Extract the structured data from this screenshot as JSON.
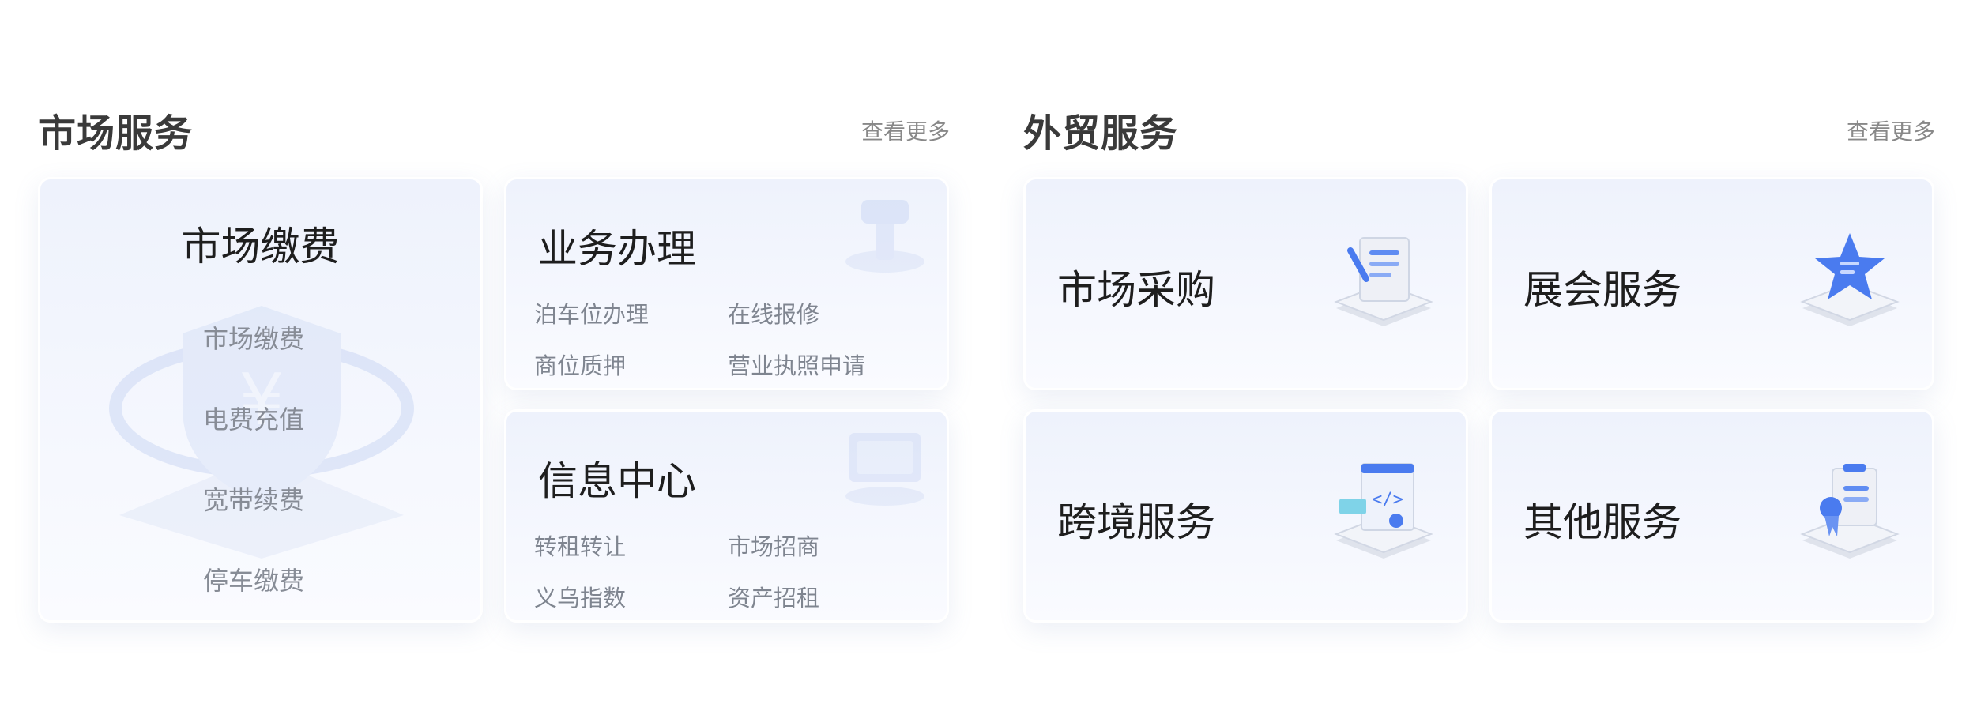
{
  "market": {
    "title": "市场服务",
    "more": "查看更多",
    "fee_card": {
      "title": "市场缴费",
      "links": [
        "市场缴费",
        "电费充值",
        "宽带续费",
        "停车缴费"
      ]
    },
    "business_card": {
      "title": "业务办理",
      "links": [
        "泊车位办理",
        "在线报修",
        "商位质押",
        "营业执照申请"
      ]
    },
    "info_card": {
      "title": "信息中心",
      "links": [
        "转租转让",
        "市场招商",
        "义乌指数",
        "资产招租"
      ]
    }
  },
  "trade": {
    "title": "外贸服务",
    "more": "查看更多",
    "cards": [
      "市场采购",
      "展会服务",
      "跨境服务",
      "其他服务"
    ]
  },
  "colors": {
    "accent": "#4a7bef",
    "title": "#3a3a3a",
    "muted": "#888888",
    "card_bg": "#eef2fc"
  },
  "icons": {
    "fee_bg": "shield-yen-icon",
    "business_bg": "hammer-stamp-icon",
    "info_bg": "monitor-icon",
    "purchase": "document-pen-icon",
    "expo": "star-badge-icon",
    "crossborder": "code-window-icon",
    "other": "certificate-icon"
  }
}
